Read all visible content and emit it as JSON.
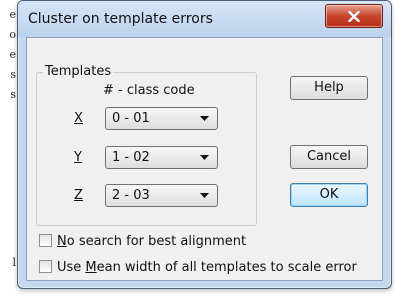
{
  "background_text": [
    "e",
    "o",
    "e",
    "s",
    "s",
    "l"
  ],
  "window": {
    "title": "Cluster on template errors",
    "close_label": "X"
  },
  "templates": {
    "group_label": "Templates",
    "column_header": "# - class code",
    "rows": [
      {
        "label": "X",
        "value": "0 - 01"
      },
      {
        "label": "Y",
        "value": "1 - 02"
      },
      {
        "label": "Z",
        "value": "2 - 03"
      }
    ]
  },
  "buttons": {
    "help": "Help",
    "cancel": "Cancel",
    "ok": "OK"
  },
  "options": {
    "no_search": {
      "mnemonic": "N",
      "rest": "o search for best alignment",
      "checked": false
    },
    "mean_width": {
      "before": "Use ",
      "mnemonic": "M",
      "rest": "ean width of all templates to scale error",
      "checked": false
    }
  },
  "icons": {
    "dropdown": "chevron-down-icon",
    "close": "close-icon"
  }
}
